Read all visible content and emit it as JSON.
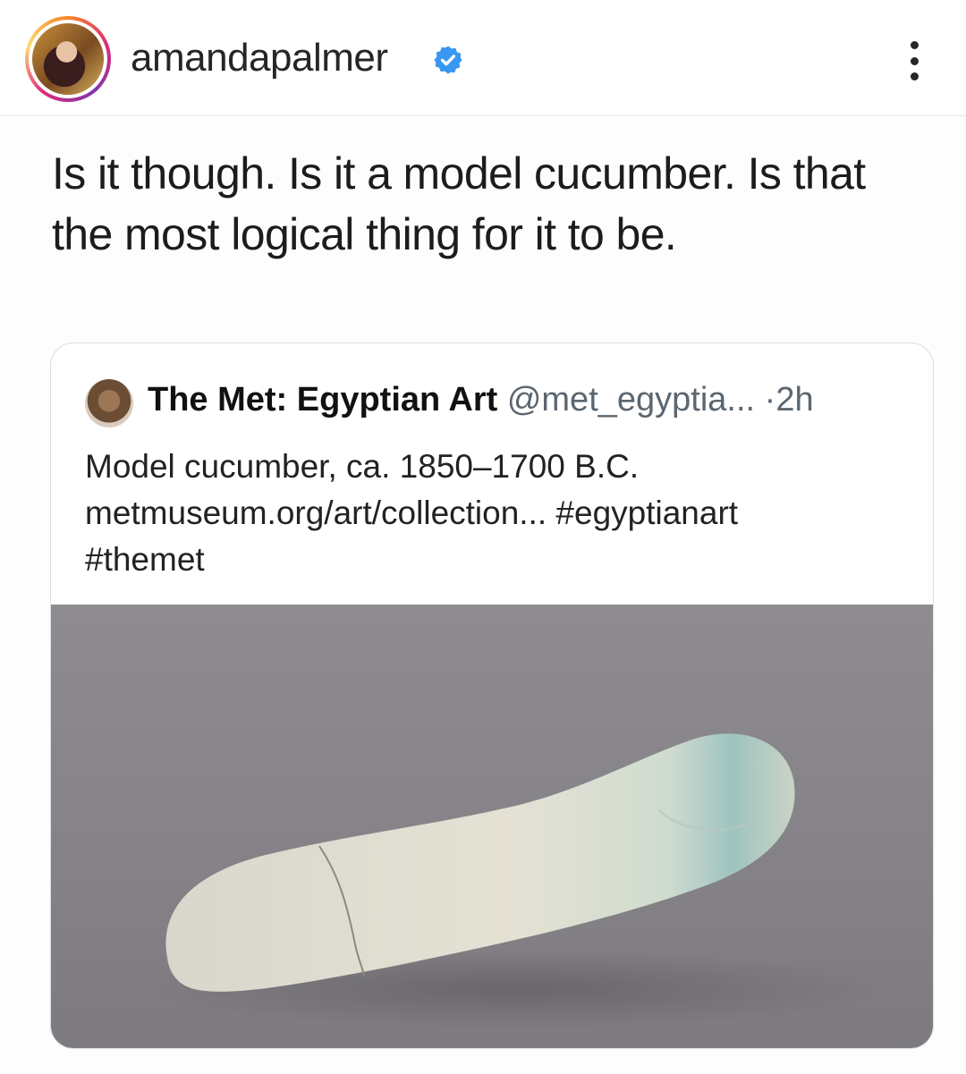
{
  "header": {
    "username": "amandapalmer",
    "avatar_icon": "profile-photo",
    "verified_icon": "verified-badge-icon",
    "more_icon": "more-vertical-icon",
    "verified_color": "#3897f0"
  },
  "post": {
    "text": "Is it though. Is it a model cucumber. Is that the most logical thing for it to be."
  },
  "quoted_tweet": {
    "author_name": "The Met: Egyptian Art",
    "handle": "@met_egyptia...",
    "separator": "·",
    "time": "2h",
    "text_line1": "Model cucumber, ca. 1850–1700 B.C.",
    "text_line2": "metmuseum.org/art/collection... #egyptianart",
    "text_line3": "#themet",
    "image_icon": "model-cucumber-photo"
  }
}
